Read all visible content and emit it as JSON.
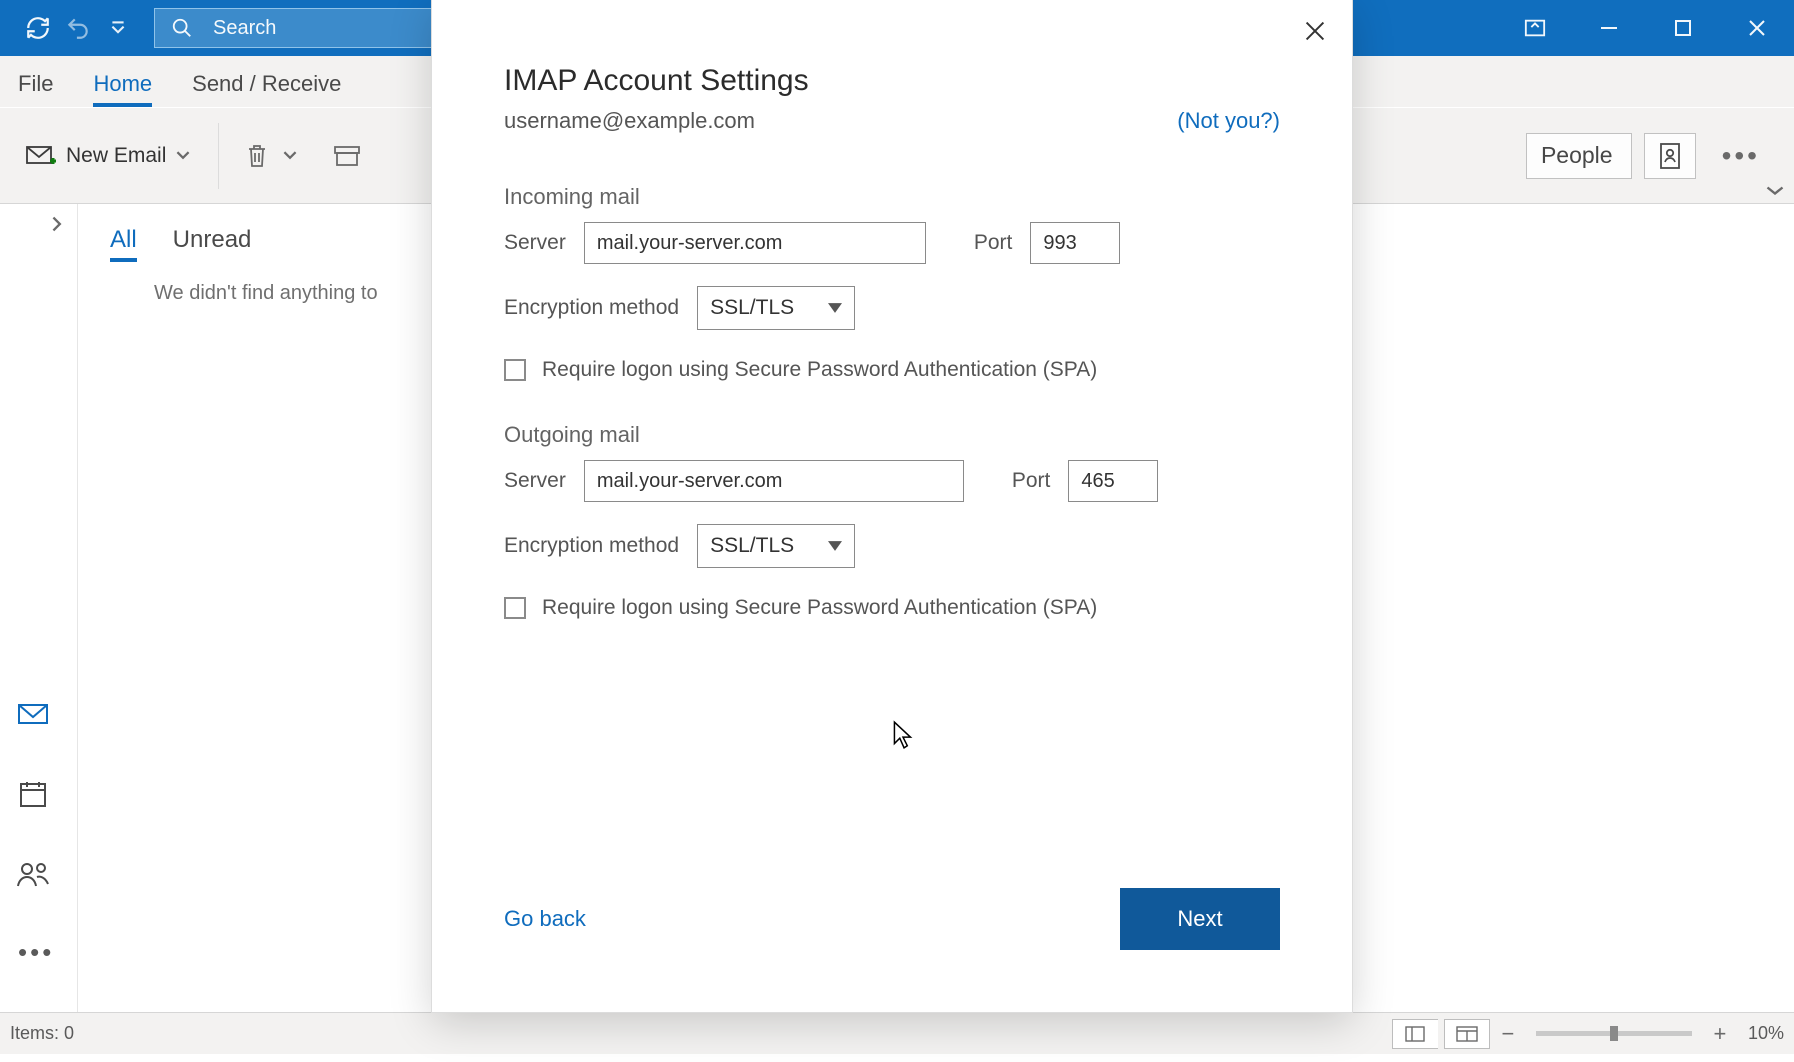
{
  "titlebar": {
    "search_placeholder": "Search"
  },
  "tabs": {
    "file": "File",
    "home": "Home",
    "sendreceive": "Send / Receive"
  },
  "ribbon": {
    "new_email": "New Email",
    "find_people": "People"
  },
  "message_list": {
    "tab_all": "All",
    "tab_unread": "Unread",
    "empty": "We didn't find anything to"
  },
  "statusbar": {
    "items": "Items: 0",
    "zoom": "10%"
  },
  "modal": {
    "title": "IMAP Account Settings",
    "email": "username@example.com",
    "not_you": "(Not you?)",
    "incoming": {
      "heading": "Incoming mail",
      "server_label": "Server",
      "server_value": "mail.your-server.com",
      "port_label": "Port",
      "port_value": "993",
      "enc_label": "Encryption method",
      "enc_value": "SSL/TLS",
      "spa": "Require logon using Secure Password Authentication (SPA)"
    },
    "outgoing": {
      "heading": "Outgoing mail",
      "server_label": "Server",
      "server_value": "mail.your-server.com",
      "port_label": "Port",
      "port_value": "465",
      "enc_label": "Encryption method",
      "enc_value": "SSL/TLS",
      "spa": "Require logon using Secure Password Authentication (SPA)"
    },
    "go_back": "Go back",
    "next": "Next"
  }
}
